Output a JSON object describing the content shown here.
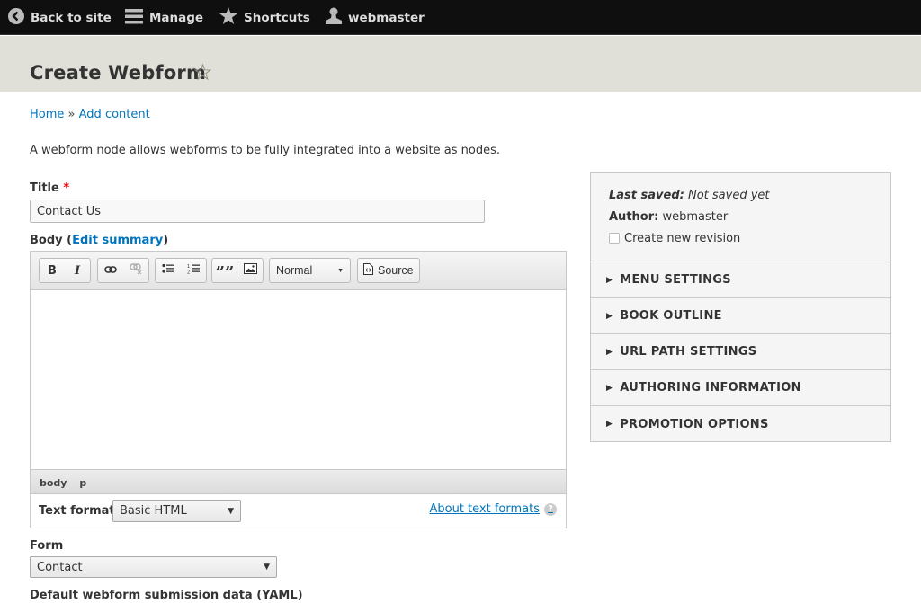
{
  "toolbar": {
    "back_label": "Back to site",
    "manage_label": "Manage",
    "shortcuts_label": "Shortcuts",
    "user_label": "webmaster"
  },
  "header": {
    "title": "Create Webform",
    "star_icon": "star-outline-icon"
  },
  "breadcrumb": {
    "items": [
      "Home",
      "Add content"
    ],
    "separator": "»"
  },
  "intro": "A webform node allows webforms to be fully integrated into a website as nodes.",
  "title_field": {
    "label": "Title",
    "required_marker": "*",
    "value": "Contact Us"
  },
  "body_field": {
    "label_prefix": "Body (",
    "link": "Edit summary",
    "label_suffix": ")",
    "toolbar": {
      "bold": "B",
      "italic": "I",
      "format_value": "Normal",
      "source_label": "Source"
    },
    "path": [
      "body",
      "p"
    ]
  },
  "text_format": {
    "label": "Text format",
    "value": "Basic HTML",
    "about_link": "About text formats",
    "help": "?"
  },
  "form_field": {
    "label": "Form",
    "value": "Contact"
  },
  "yaml_label": "Default webform submission data (YAML)",
  "sidebar": {
    "last_saved_label": "Last saved:",
    "last_saved_value": "Not saved yet",
    "author_label": "Author:",
    "author_value": "webmaster",
    "revision_label": "Create new revision",
    "revision_checked": false,
    "sections": [
      "MENU SETTINGS",
      "BOOK OUTLINE",
      "URL PATH SETTINGS",
      "AUTHORING INFORMATION",
      "PROMOTION OPTIONS"
    ]
  },
  "colors": {
    "link": "#0074bd",
    "toolbar_bg": "#0f0f0f",
    "header_bg": "#e0e0d8",
    "required": "#ee0000"
  }
}
